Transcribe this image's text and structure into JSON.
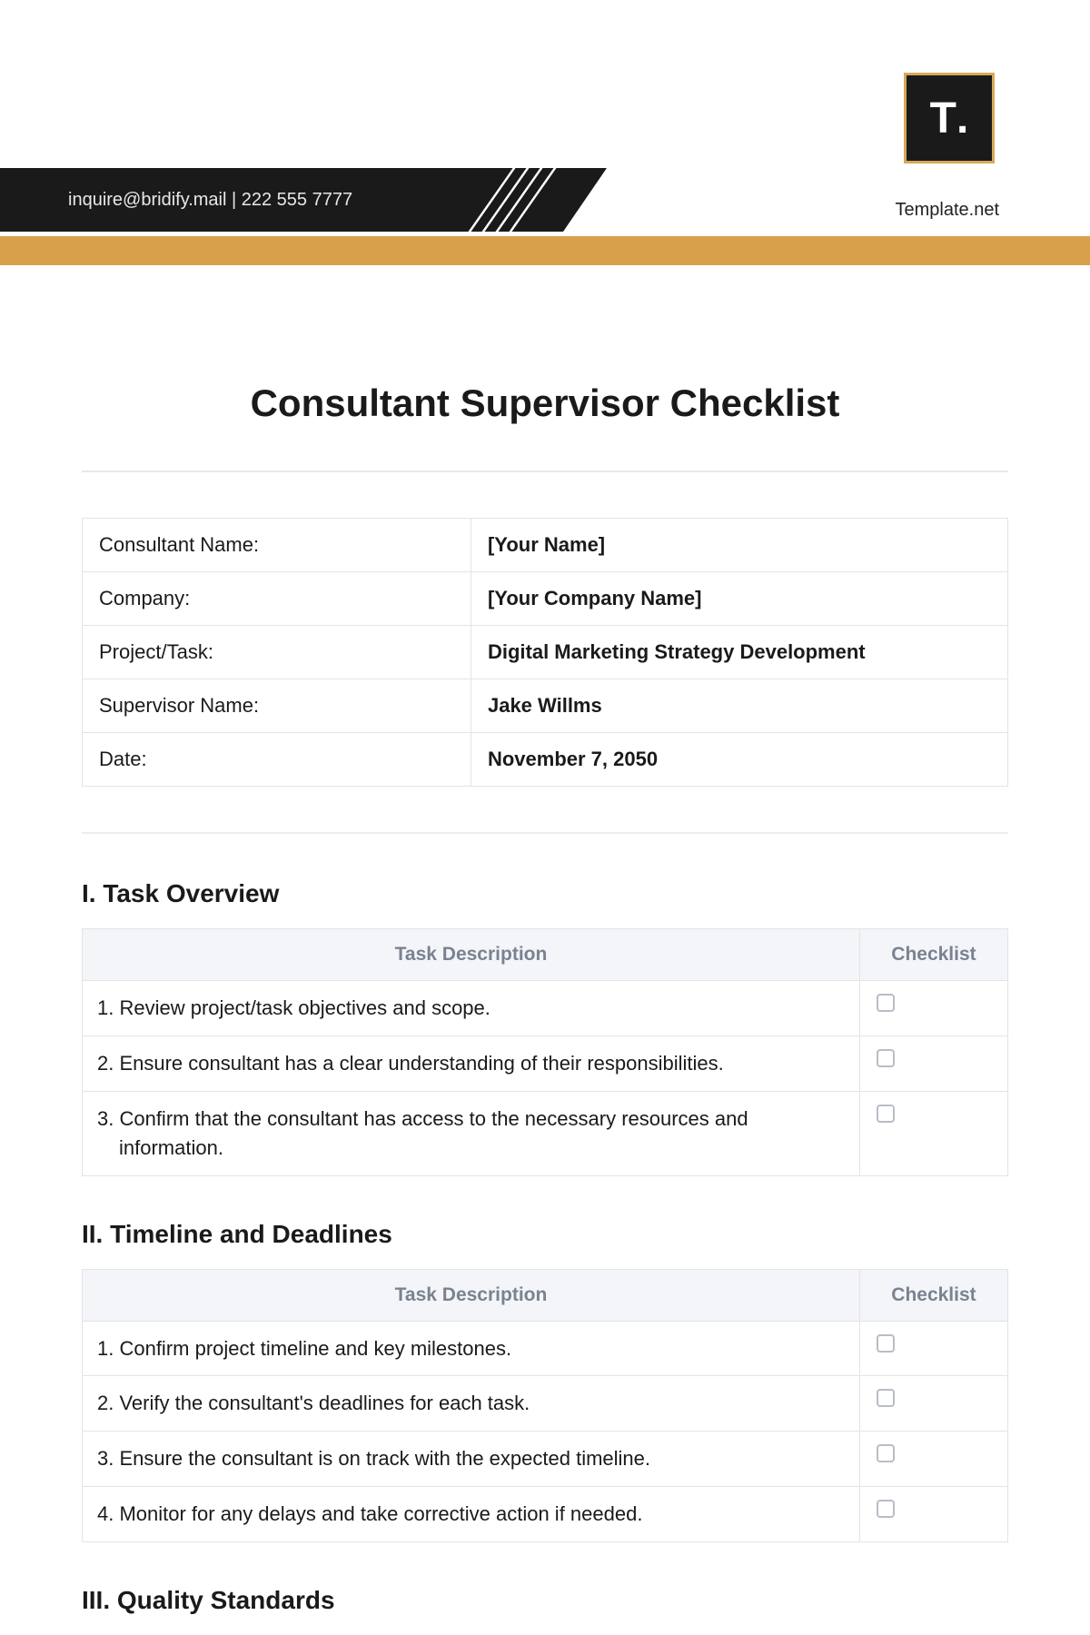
{
  "header": {
    "contact": "inquire@bridify.mail  |  222 555 7777",
    "brand": "Template.net",
    "logo_letter": "T",
    "logo_dot": "."
  },
  "title": "Consultant Supervisor Checklist",
  "info": [
    {
      "label": "Consultant Name:",
      "value": "[Your Name]"
    },
    {
      "label": "Company:",
      "value": "[Your Company Name]"
    },
    {
      "label": "Project/Task:",
      "value": "Digital Marketing Strategy Development"
    },
    {
      "label": "Supervisor Name:",
      "value": "Jake Willms"
    },
    {
      "label": "Date:",
      "value": "November 7, 2050"
    }
  ],
  "columns": {
    "desc": "Task Description",
    "check": "Checklist"
  },
  "sections": [
    {
      "heading": "I. Task Overview",
      "items": [
        "1. Review project/task objectives and scope.",
        "2. Ensure consultant has a clear understanding of their responsibilities.",
        "3. Confirm that the consultant has access to the necessary resources and information."
      ]
    },
    {
      "heading": "II. Timeline and Deadlines",
      "items": [
        "1. Confirm project timeline and key milestones.",
        "2. Verify the consultant's deadlines for each task.",
        "3. Ensure the consultant is on track with the expected timeline.",
        "4. Monitor for any delays and take corrective action if needed."
      ]
    },
    {
      "heading": "III. Quality Standards",
      "items": []
    }
  ]
}
